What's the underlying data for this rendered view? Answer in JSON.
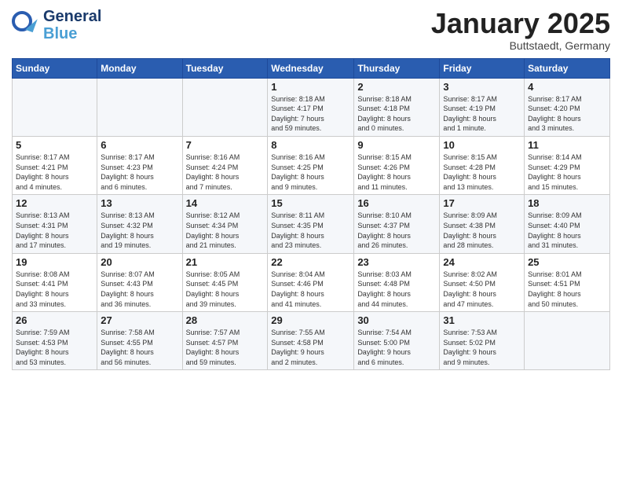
{
  "header": {
    "logo": {
      "line1": "General",
      "line2": "Blue",
      "tagline": "Blue"
    },
    "title": "January 2025",
    "subtitle": "Buttstaedt, Germany"
  },
  "weekdays": [
    "Sunday",
    "Monday",
    "Tuesday",
    "Wednesday",
    "Thursday",
    "Friday",
    "Saturday"
  ],
  "weeks": [
    [
      {
        "day": "",
        "info": ""
      },
      {
        "day": "",
        "info": ""
      },
      {
        "day": "",
        "info": ""
      },
      {
        "day": "1",
        "info": "Sunrise: 8:18 AM\nSunset: 4:17 PM\nDaylight: 7 hours\nand 59 minutes."
      },
      {
        "day": "2",
        "info": "Sunrise: 8:18 AM\nSunset: 4:18 PM\nDaylight: 8 hours\nand 0 minutes."
      },
      {
        "day": "3",
        "info": "Sunrise: 8:17 AM\nSunset: 4:19 PM\nDaylight: 8 hours\nand 1 minute."
      },
      {
        "day": "4",
        "info": "Sunrise: 8:17 AM\nSunset: 4:20 PM\nDaylight: 8 hours\nand 3 minutes."
      }
    ],
    [
      {
        "day": "5",
        "info": "Sunrise: 8:17 AM\nSunset: 4:21 PM\nDaylight: 8 hours\nand 4 minutes."
      },
      {
        "day": "6",
        "info": "Sunrise: 8:17 AM\nSunset: 4:23 PM\nDaylight: 8 hours\nand 6 minutes."
      },
      {
        "day": "7",
        "info": "Sunrise: 8:16 AM\nSunset: 4:24 PM\nDaylight: 8 hours\nand 7 minutes."
      },
      {
        "day": "8",
        "info": "Sunrise: 8:16 AM\nSunset: 4:25 PM\nDaylight: 8 hours\nand 9 minutes."
      },
      {
        "day": "9",
        "info": "Sunrise: 8:15 AM\nSunset: 4:26 PM\nDaylight: 8 hours\nand 11 minutes."
      },
      {
        "day": "10",
        "info": "Sunrise: 8:15 AM\nSunset: 4:28 PM\nDaylight: 8 hours\nand 13 minutes."
      },
      {
        "day": "11",
        "info": "Sunrise: 8:14 AM\nSunset: 4:29 PM\nDaylight: 8 hours\nand 15 minutes."
      }
    ],
    [
      {
        "day": "12",
        "info": "Sunrise: 8:13 AM\nSunset: 4:31 PM\nDaylight: 8 hours\nand 17 minutes."
      },
      {
        "day": "13",
        "info": "Sunrise: 8:13 AM\nSunset: 4:32 PM\nDaylight: 8 hours\nand 19 minutes."
      },
      {
        "day": "14",
        "info": "Sunrise: 8:12 AM\nSunset: 4:34 PM\nDaylight: 8 hours\nand 21 minutes."
      },
      {
        "day": "15",
        "info": "Sunrise: 8:11 AM\nSunset: 4:35 PM\nDaylight: 8 hours\nand 23 minutes."
      },
      {
        "day": "16",
        "info": "Sunrise: 8:10 AM\nSunset: 4:37 PM\nDaylight: 8 hours\nand 26 minutes."
      },
      {
        "day": "17",
        "info": "Sunrise: 8:09 AM\nSunset: 4:38 PM\nDaylight: 8 hours\nand 28 minutes."
      },
      {
        "day": "18",
        "info": "Sunrise: 8:09 AM\nSunset: 4:40 PM\nDaylight: 8 hours\nand 31 minutes."
      }
    ],
    [
      {
        "day": "19",
        "info": "Sunrise: 8:08 AM\nSunset: 4:41 PM\nDaylight: 8 hours\nand 33 minutes."
      },
      {
        "day": "20",
        "info": "Sunrise: 8:07 AM\nSunset: 4:43 PM\nDaylight: 8 hours\nand 36 minutes."
      },
      {
        "day": "21",
        "info": "Sunrise: 8:05 AM\nSunset: 4:45 PM\nDaylight: 8 hours\nand 39 minutes."
      },
      {
        "day": "22",
        "info": "Sunrise: 8:04 AM\nSunset: 4:46 PM\nDaylight: 8 hours\nand 41 minutes."
      },
      {
        "day": "23",
        "info": "Sunrise: 8:03 AM\nSunset: 4:48 PM\nDaylight: 8 hours\nand 44 minutes."
      },
      {
        "day": "24",
        "info": "Sunrise: 8:02 AM\nSunset: 4:50 PM\nDaylight: 8 hours\nand 47 minutes."
      },
      {
        "day": "25",
        "info": "Sunrise: 8:01 AM\nSunset: 4:51 PM\nDaylight: 8 hours\nand 50 minutes."
      }
    ],
    [
      {
        "day": "26",
        "info": "Sunrise: 7:59 AM\nSunset: 4:53 PM\nDaylight: 8 hours\nand 53 minutes."
      },
      {
        "day": "27",
        "info": "Sunrise: 7:58 AM\nSunset: 4:55 PM\nDaylight: 8 hours\nand 56 minutes."
      },
      {
        "day": "28",
        "info": "Sunrise: 7:57 AM\nSunset: 4:57 PM\nDaylight: 8 hours\nand 59 minutes."
      },
      {
        "day": "29",
        "info": "Sunrise: 7:55 AM\nSunset: 4:58 PM\nDaylight: 9 hours\nand 2 minutes."
      },
      {
        "day": "30",
        "info": "Sunrise: 7:54 AM\nSunset: 5:00 PM\nDaylight: 9 hours\nand 6 minutes."
      },
      {
        "day": "31",
        "info": "Sunrise: 7:53 AM\nSunset: 5:02 PM\nDaylight: 9 hours\nand 9 minutes."
      },
      {
        "day": "",
        "info": ""
      }
    ]
  ]
}
